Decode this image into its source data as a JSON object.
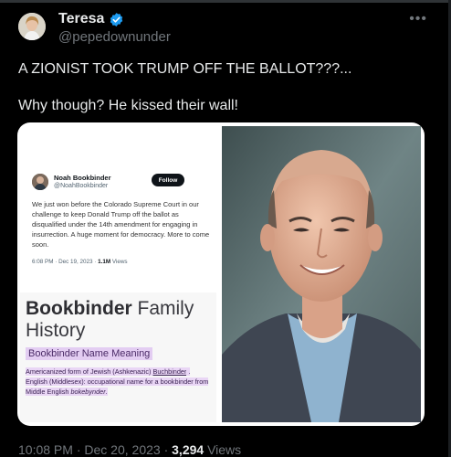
{
  "tweet": {
    "author": {
      "display_name": "Teresa",
      "handle": "@pepedownunder",
      "verified": true
    },
    "more_icon": "ellipsis-icon",
    "text_lines": [
      "A ZIONIST TOOK TRUMP OFF THE BALLOT???...",
      "Why though? He kissed their wall!"
    ],
    "footer": {
      "time": "10:08 PM",
      "date": "Dec 20, 2023",
      "views_count": "3,294",
      "views_label": "Views"
    }
  },
  "embedded_post": {
    "author_name": "Noah Bookbinder",
    "author_handle": "@NoahBookbinder",
    "follow_label": "Follow",
    "text": "We just won before the Colorado Supreme Court in our challenge to keep Donald Trump off the ballot as disqualified under the 14th amendment for engaging in insurrection. A huge moment for democracy. More to come soon.",
    "time": "6:08 PM",
    "date": "Dec 19, 2023",
    "views_count": "1.1M",
    "views_label": "Views"
  },
  "family_history": {
    "title_bold": "Bookbinder",
    "title_rest": " Family History",
    "subtitle": "Bookbinder Name Meaning",
    "body_prefix": "Americanized form of Jewish (Ashkenazic) ",
    "body_link": "Buchbinder",
    "body_middle": " . English (Middlesex): occupational name for a bookbinder from Middle English ",
    "body_italic": "bokebynder",
    "body_end": "."
  },
  "colors": {
    "background": "#000000",
    "text": "#e7e9ea",
    "muted": "#71767b",
    "verified_badge": "#1d9bf0"
  }
}
